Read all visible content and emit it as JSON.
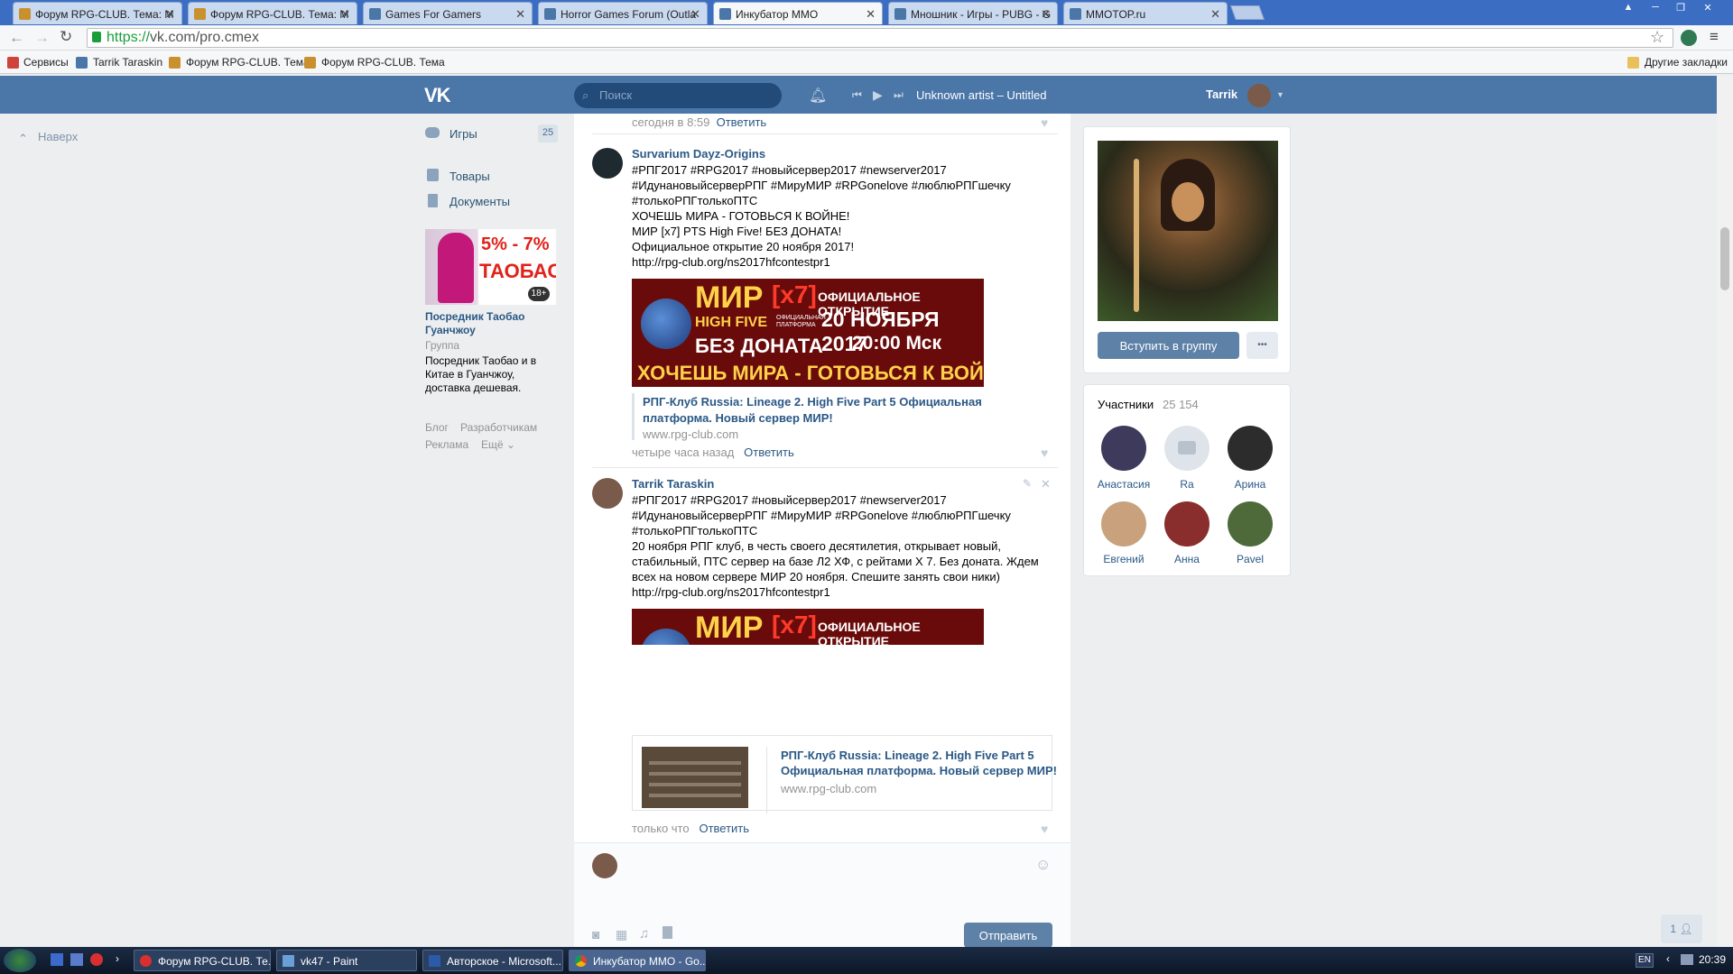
{
  "browser": {
    "tabs": [
      {
        "label": "Форум RPG-CLUB. Тема: М",
        "active": false
      },
      {
        "label": "Форум RPG-CLUB. Тема: М",
        "active": false
      },
      {
        "label": "Games For Gamers",
        "active": false
      },
      {
        "label": "Horror Games Forum (Outla",
        "active": false
      },
      {
        "label": "Инкубатор MMO",
        "active": true
      },
      {
        "label": "Мношник - Игры - PUBG - G",
        "active": false
      },
      {
        "label": "MMOTOP.ru",
        "active": false
      }
    ],
    "url_scheme": "https://",
    "url_rest": "vk.com/pro.cmex",
    "bookmarks": [
      "Сервисы",
      "Tarrik Taraskin",
      "Форум RPG-CLUB. Тема",
      "Форум RPG-CLUB. Тема"
    ],
    "other_bookmarks": "Другие закладки"
  },
  "vk_header": {
    "logo": "VK",
    "search_placeholder": "Поиск",
    "track": "Unknown artist – Untitled",
    "user_name": "Tarrik"
  },
  "left_nav": {
    "back_to_top": "Наверх",
    "items": [
      {
        "label": "Игры",
        "badge": "25",
        "icon": "gamepad-icon"
      },
      {
        "label": "Товары",
        "icon": "bag-icon"
      },
      {
        "label": "Документы",
        "icon": "document-icon"
      }
    ],
    "ad": {
      "banner_percent": "5% - 7%",
      "banner_word": "ТАОБАО",
      "age_badge": "18+",
      "title": "Посредник Таобао Гуанчжоу",
      "type": "Группа",
      "description": "Посредник Таобао и в Китае в Гуанчжоу, доставка дешевая."
    },
    "footer_links": [
      "Блог",
      "Разработчикам",
      "Реклама",
      "Ещё ⌄"
    ]
  },
  "feed": {
    "top_meta": {
      "time": "сегодня в 8:59",
      "reply": "Ответить"
    },
    "comments": [
      {
        "author": "Survarium Dayz-Origins",
        "hashtags_1": "#РПГ2017 #RPG2017 #новыйсервер2017 #newserver2017",
        "hashtags_2": "#ИдунановыйсерверРПГ #МируМИР #RPGonelove #люблюРПГшечку",
        "hashtags_3": "#толькоРПГтолькоПТС",
        "line_1": "ХОЧЕШЬ МИРА - ГОТОВЬСЯ К ВОЙНЕ!",
        "line_2": "МИР [x7] PTS High Five! БЕЗ ДОНАТА!",
        "line_3": "Официальное открытие 20 ноября 2017!",
        "link": "http://rpg-club.org/ns2017hfcontestpr1",
        "banner": {
          "mir": "МИР",
          "x7": "[x7]",
          "official": "ОФИЦИАЛЬНОЕ ОТКРЫТИЕ",
          "highfive": "HIGH FIVE",
          "platform": "ОФИЦИАЛЬНАЯ ПЛАТФОРМА",
          "date": "20 НОЯБРЯ 2017",
          "time": "20:00 Мск",
          "nodonate": "БЕЗ ДОНАТА",
          "slogan": "ХОЧЕШЬ МИРА - ГОТОВЬСЯ К ВОЙНЕ"
        },
        "snippet_title": "РПГ-Клуб Russia: Lineage 2. High Five Part 5 Официальная платформа. Новый сервер МИР!",
        "snippet_domain": "www.rpg-club.com",
        "time": "четыре часа назад",
        "reply": "Ответить"
      },
      {
        "author": "Tarrik Taraskin",
        "hashtags_1": "#РПГ2017 #RPG2017 #новыйсервер2017 #newserver2017",
        "hashtags_2": "#ИдунановыйсерверРПГ #МируМИР #RPGonelove #люблюРПГшечку",
        "hashtags_3": "#толькоРПГтолькоПТС",
        "body_1": "20 ноября РПГ клуб, в честь своего десятилетия, открывает новый,",
        "body_2": "стабильный, ПТС сервер на базе Л2 ХФ, с рейтами Х 7. Без доната. Ждем",
        "body_3": "всех на новом сервере МИР 20 ноября. Спешите занять свои ники)",
        "link": "http://rpg-club.org/ns2017hfcontestpr1",
        "snippet_title_1": "РПГ-Клуб Russia: Lineage 2. High Five Part 5",
        "snippet_title_2": "Официальная платформа. Новый сервер МИР!",
        "snippet_domain": "www.rpg-club.com",
        "time": "только что",
        "reply": "Ответить"
      }
    ],
    "submit": "Отправить"
  },
  "right_col": {
    "join_button": "Вступить в группу",
    "more_button": "•••",
    "members_label": "Участники",
    "members_count": "25 154",
    "members": [
      {
        "name": "Анастасия",
        "color": "#3d3a5c"
      },
      {
        "name": "Ra",
        "color": "#dfe4ea"
      },
      {
        "name": "Арина",
        "color": "#2c2c2c"
      },
      {
        "name": "Евгений",
        "color": "#c9a27d"
      },
      {
        "name": "Анна",
        "color": "#8a2d2d"
      },
      {
        "name": "Pavel",
        "color": "#4f6a3a"
      }
    ]
  },
  "page_bottom_right_badge": "1",
  "taskbar": {
    "tasks": [
      {
        "label": "Форум RPG-CLUB. Те..."
      },
      {
        "label": "vk47 - Paint"
      },
      {
        "label": "Авторское - Microsoft..."
      },
      {
        "label": "Инкубатор MMO - Go..."
      }
    ],
    "lang": "EN",
    "clock": "20:39"
  },
  "colors": {
    "vk_blue": "#4a76a8",
    "link": "#2a5885",
    "banner_red": "#6a0b0b",
    "gold": "#ffd24a"
  }
}
